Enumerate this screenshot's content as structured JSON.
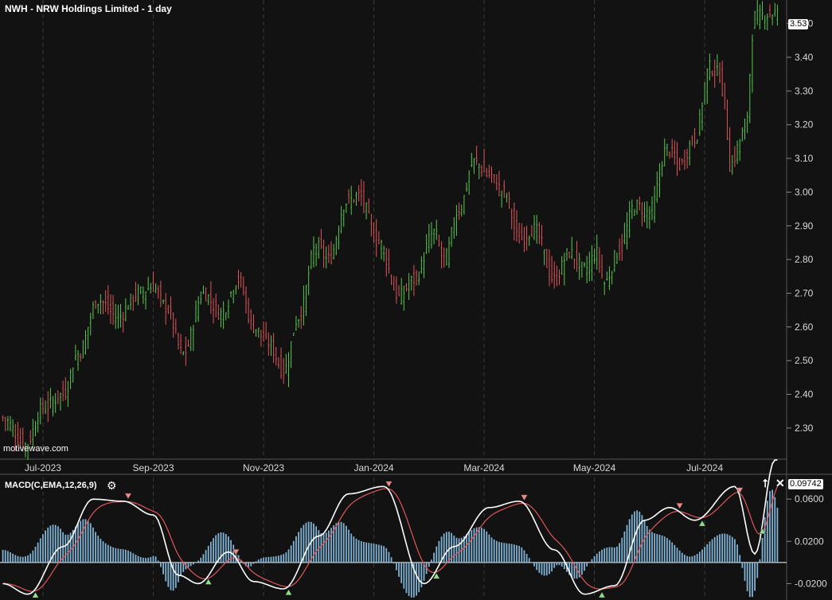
{
  "header": {
    "title": "NWH - NRW Holdings Limited - 1 day",
    "watermark": "motivewave.com"
  },
  "macd_panel": {
    "label": "MACD(C,EMA,12,26,9)",
    "settings_icon": "gear-icon",
    "expand_icon": "arrow-up-icon",
    "close_icon": "close-icon"
  },
  "colors": {
    "background": "#121212",
    "up": "#57c84d",
    "down": "#e0555a",
    "macd_line": "#ffffff",
    "signal_line": "#e0555a",
    "histogram": "#7fb4d6",
    "grid": "#3a3a3a",
    "axis_text": "#d8d8d8"
  },
  "chart_data": [
    {
      "type": "candlestick",
      "title": "NWH - NRW Holdings Limited - 1 day",
      "x_tick_labels": [
        "Jul-2023",
        "Sep-2023",
        "Nov-2023",
        "Jan-2024",
        "Mar-2024",
        "May-2024",
        "Jul-2024"
      ],
      "y_tick_labels": [
        "2.30",
        "2.40",
        "2.50",
        "2.60",
        "2.70",
        "2.80",
        "2.90",
        "3.00",
        "3.10",
        "3.20",
        "3.30",
        "3.40",
        "3.50"
      ],
      "ylim": [
        2.21,
        3.57
      ],
      "last_price_label": "3.53",
      "grid": "vertical dashed",
      "anchors": [
        [
          0,
          2.33
        ],
        [
          9,
          2.25
        ],
        [
          16,
          2.36
        ],
        [
          24,
          2.4
        ],
        [
          30,
          2.52
        ],
        [
          38,
          2.68
        ],
        [
          46,
          2.63
        ],
        [
          54,
          2.7
        ],
        [
          60,
          2.72
        ],
        [
          65,
          2.66
        ],
        [
          72,
          2.52
        ],
        [
          80,
          2.7
        ],
        [
          87,
          2.64
        ],
        [
          94,
          2.74
        ],
        [
          100,
          2.6
        ],
        [
          106,
          2.55
        ],
        [
          112,
          2.47
        ],
        [
          118,
          2.63
        ],
        [
          125,
          2.84
        ],
        [
          130,
          2.8
        ],
        [
          137,
          2.97
        ],
        [
          142,
          2.99
        ],
        [
          150,
          2.85
        ],
        [
          158,
          2.69
        ],
        [
          164,
          2.74
        ],
        [
          172,
          2.88
        ],
        [
          176,
          2.8
        ],
        [
          182,
          2.95
        ],
        [
          188,
          3.09
        ],
        [
          194,
          3.05
        ],
        [
          200,
          3.0
        ],
        [
          206,
          2.86
        ],
        [
          212,
          2.89
        ],
        [
          220,
          2.74
        ],
        [
          226,
          2.82
        ],
        [
          232,
          2.77
        ],
        [
          237,
          2.82
        ],
        [
          240,
          2.73
        ],
        [
          246,
          2.83
        ],
        [
          252,
          2.96
        ],
        [
          258,
          2.94
        ],
        [
          265,
          3.13
        ],
        [
          270,
          3.08
        ],
        [
          276,
          3.16
        ],
        [
          282,
          3.37
        ],
        [
          286,
          3.35
        ],
        [
          288,
          3.26
        ],
        [
          290,
          3.08
        ],
        [
          296,
          3.18
        ],
        [
          300,
          3.52
        ],
        [
          306,
          3.53
        ]
      ]
    },
    {
      "type": "macd",
      "label": "MACD(C,EMA,12,26,9)",
      "y_tick_labels": [
        "0.0600",
        "0.0200",
        "-0.0200"
      ],
      "ylim": [
        -0.0325,
        0.0805
      ],
      "last_value_label": "0.09742",
      "series": [
        {
          "values": [
            [
              0,
              -0.02
            ],
            [
              10,
              -0.03
            ],
            [
              24,
              0.015
            ],
            [
              36,
              0.06
            ],
            [
              48,
              0.058
            ],
            [
              60,
              0.045
            ],
            [
              70,
              -0.012
            ],
            [
              78,
              -0.02
            ],
            [
              90,
              0.01
            ],
            [
              100,
              -0.018
            ],
            [
              112,
              -0.025
            ],
            [
              126,
              0.025
            ],
            [
              138,
              0.065
            ],
            [
              152,
              0.072
            ],
            [
              168,
              -0.02
            ],
            [
              180,
              0.015
            ],
            [
              194,
              0.052
            ],
            [
              206,
              0.058
            ],
            [
              220,
              0.012
            ],
            [
              232,
              -0.03
            ],
            [
              244,
              -0.022
            ],
            [
              256,
              0.04
            ],
            [
              266,
              0.052
            ],
            [
              276,
              0.04
            ],
            [
              292,
              0.072
            ],
            [
              300,
              0.008
            ],
            [
              308,
              0.097
            ]
          ]
        }
      ]
    }
  ]
}
